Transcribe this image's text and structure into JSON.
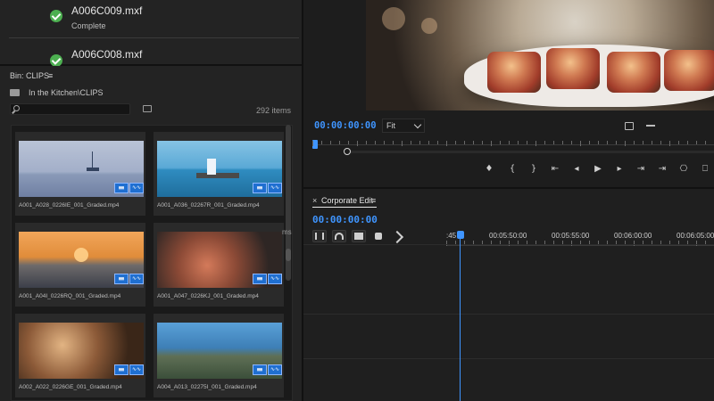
{
  "ingest": {
    "items": [
      {
        "name": "A006C009.mxf",
        "status": "Complete"
      },
      {
        "name": "A006C008.mxf",
        "status": ""
      }
    ]
  },
  "bin": {
    "title": "Bin: CLIPS",
    "path": "In the Kitchen\\CLIPS",
    "item_count": "292 items",
    "search_placeholder": "",
    "truncated_text": "ms",
    "tiles": [
      {
        "label": "A001_A028_0226IE_001_Graded.mp4"
      },
      {
        "label": "A001_A036_02267R_001_Graded.mp4"
      },
      {
        "label": "A001_A04I_0226RQ_001_Graded.mp4"
      },
      {
        "label": "A001_A047_0226KJ_001_Graded.mp4"
      },
      {
        "label": "A002_A022_0226GE_001_Graded.mp4"
      },
      {
        "label": "A004_A013_02275I_001_Graded.mp4"
      }
    ]
  },
  "program_monitor": {
    "timecode": "00:00:00:00",
    "fit": "Fit",
    "transport": [
      "♦",
      "{",
      "}",
      "⇤",
      "◂",
      "▶",
      "▸",
      "⇥",
      "⇥",
      "⎔",
      "⎕"
    ]
  },
  "timeline": {
    "tab_close": "×",
    "tab_title": "Corporate Edit",
    "timecode": "00:00:00:00",
    "ruler_labels": [
      ":45",
      "00:05:50:00",
      "00:05:55:00",
      "00:06:00:00",
      "00:06:05:00"
    ]
  },
  "icons": {
    "menu": "≡",
    "checkmark": "check-icon"
  },
  "colors": {
    "accent": "#3f95ff",
    "success": "#4caf50",
    "badge": "#1f6fd1"
  }
}
